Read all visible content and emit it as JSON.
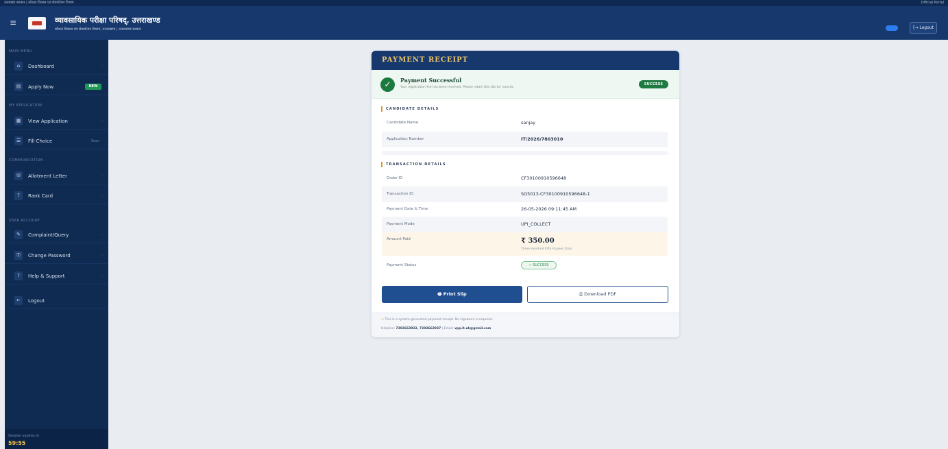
{
  "topbar": {
    "breadcrumb": "उत्तराखंड सरकार  |  कौशल विकास एवं सेवायोजन विभाग",
    "right_text": "Official Portal"
  },
  "header": {
    "title": "व्यावसायिक परीक्षा परिषद्, उत्तराखण्ड",
    "subtitle": "कौशल विकास एवं सेवायोजन विभाग, उत्तराखण्ड | उत्तराखण्ड सरकार",
    "logout_label": "[→ Logout",
    "toggle_color": "#2e7df0"
  },
  "sidebar": {
    "sections": [
      {
        "label": "MAIN MENU"
      },
      {
        "label": "MY APPLICATION"
      },
      {
        "label": "COMMUNICATION"
      },
      {
        "label": "USER ACCOUNT"
      }
    ],
    "items": [
      {
        "label": "Dashboard",
        "icon": "home-icon"
      },
      {
        "label": "Apply Now",
        "icon": "document-icon",
        "badge": "NEW"
      },
      {
        "label": "View Application",
        "icon": "file-icon"
      },
      {
        "label": "Fill Choice",
        "icon": "list-icon",
        "pill": "Soon"
      },
      {
        "label": "Allotment Letter",
        "icon": "letter-icon"
      },
      {
        "label": "Rank Card",
        "icon": "rank-icon"
      },
      {
        "label": "Complaint/Query",
        "icon": "chat-icon"
      },
      {
        "label": "Change Password",
        "icon": "lock-icon"
      },
      {
        "label": "Help & Support",
        "icon": "help-icon"
      },
      {
        "label": "Logout",
        "icon": "logout-icon"
      }
    ],
    "footer": {
      "label": "Session expires in",
      "timer": "59:55"
    }
  },
  "receipt": {
    "title": "PAYMENT RECEIPT",
    "success": {
      "title": "Payment Successful",
      "subtitle": "Your registration fee has been received. Please retain this slip for records.",
      "badge": "SUCCESS"
    },
    "candidate": {
      "heading": "CANDIDATE DETAILS",
      "rows": [
        {
          "label": "Candidate Name",
          "value": "sanjay"
        },
        {
          "label": "Application Number",
          "value": "IT/2026/7803010"
        }
      ]
    },
    "transaction": {
      "heading": "TRANSACTION DETAILS",
      "rows": [
        {
          "label": "Order ID",
          "value": "CF30100910596648"
        },
        {
          "label": "Transaction ID",
          "value": "SG5013-CF30100910596648-1"
        },
        {
          "label": "Payment Date & Time",
          "value": "26-05-2026 09:11:45 AM"
        },
        {
          "label": "Payment Mode",
          "value": "UPI_COLLECT"
        }
      ],
      "amount": {
        "label": "Amount Paid",
        "value": "₹ 350.00",
        "words": "Three Hundred Fifty Rupees Only"
      },
      "status": {
        "label": "Payment Status",
        "value": "✓ SUCCESS"
      }
    },
    "actions": {
      "print_label": "🖶  Print Slip",
      "pdf_label": "⎙  Download PDF"
    },
    "footer": {
      "note": "This is a system-generated payment receipt. No signature is required.",
      "helpline_prefix": "Helpline:",
      "helpline_numbers": "7302663922, 7302663937",
      "email_prefix": "| Email:",
      "email": "vpp.it.uk@gmail.com"
    }
  },
  "colors": {
    "header_bg": "#17386c",
    "sidebar_bg": "#0f2b52",
    "accent_gold": "#e9c46a",
    "success_green": "#1d7a42",
    "primary_blue": "#1f4f90"
  }
}
